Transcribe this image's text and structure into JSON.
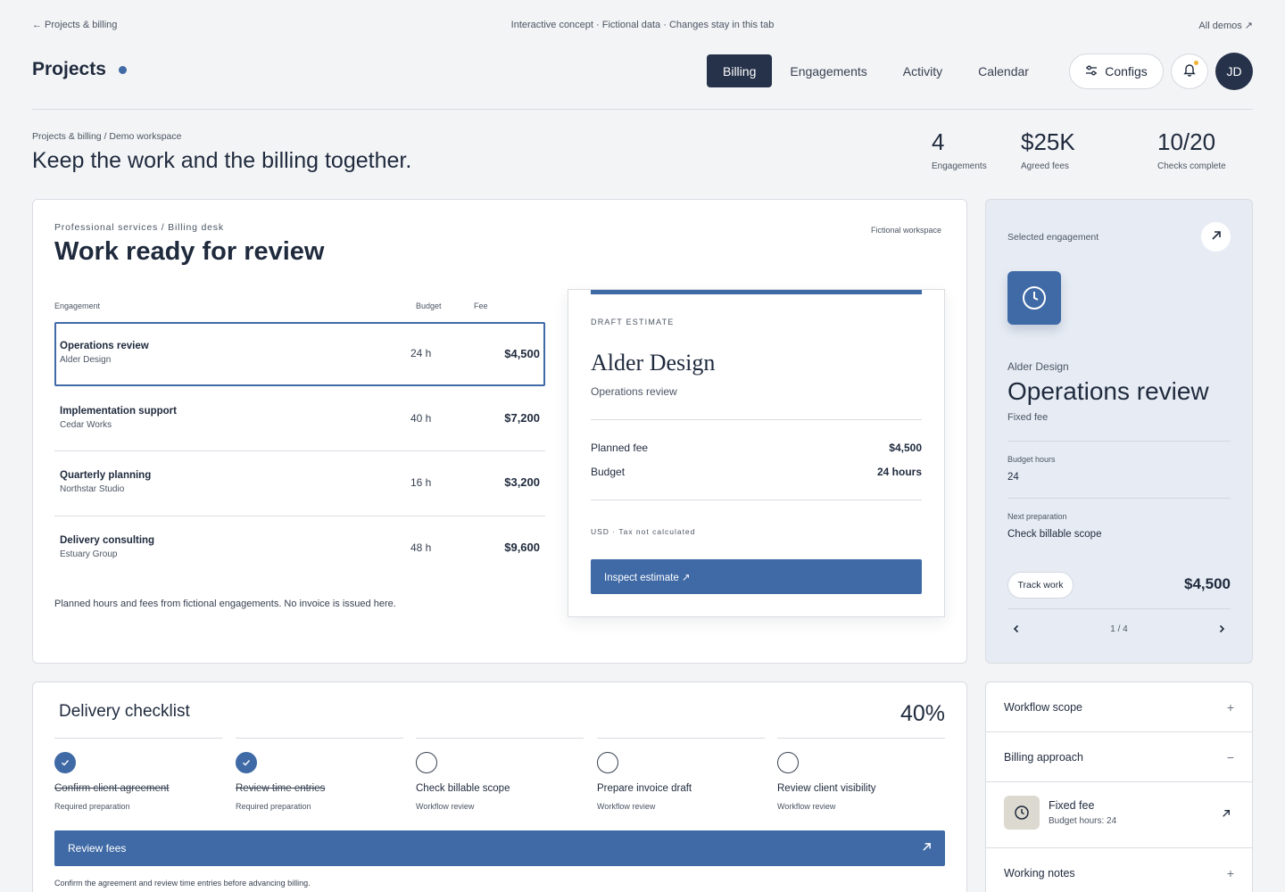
{
  "topbar": {
    "back": "← Projects & billing",
    "notice": "Interactive concept · Fictional data · Changes stay in this tab",
    "demos": "All demos ↗"
  },
  "header": {
    "title": "Projects",
    "tabs": [
      {
        "label": "Billing",
        "active": true
      },
      {
        "label": "Engagements",
        "active": false
      },
      {
        "label": "Activity",
        "active": false
      },
      {
        "label": "Calendar",
        "active": false
      }
    ],
    "configs_label": "Configs",
    "avatar_initials": "JD"
  },
  "intro": {
    "breadcrumb": "Projects & billing / Demo workspace",
    "headline": "Keep the work and the billing together.",
    "stats": [
      {
        "value": "4",
        "label": "Engagements"
      },
      {
        "value": "$25K",
        "label": "Agreed fees"
      },
      {
        "value": "10/20",
        "label": "Checks complete"
      }
    ]
  },
  "review": {
    "eyebrow": "Professional services / Billing desk",
    "title": "Work ready for review",
    "badge": "Fictional workspace",
    "columns": {
      "engagement": "Engagement",
      "budget": "Budget",
      "fee": "Fee"
    },
    "rows": [
      {
        "name": "Operations review",
        "client": "Alder Design",
        "hours": "24 h",
        "fee": "$4,500",
        "selected": true
      },
      {
        "name": "Implementation support",
        "client": "Cedar Works",
        "hours": "40 h",
        "fee": "$7,200",
        "selected": false
      },
      {
        "name": "Quarterly planning",
        "client": "Northstar Studio",
        "hours": "16 h",
        "fee": "$3,200",
        "selected": false
      },
      {
        "name": "Delivery consulting",
        "client": "Estuary Group",
        "hours": "48 h",
        "fee": "$9,600",
        "selected": false
      }
    ],
    "note": "Planned hours and fees from fictional engagements. No invoice is issued here."
  },
  "estimate": {
    "eyebrow": "DRAFT ESTIMATE",
    "client": "Alder Design",
    "engagement": "Operations review",
    "planned_fee_label": "Planned fee",
    "planned_fee_value": "$4,500",
    "budget_label": "Budget",
    "budget_value": "24 hours",
    "note": "USD · Tax not calculated",
    "button": "Inspect estimate ↗"
  },
  "selected": {
    "eyebrow": "Selected engagement",
    "client": "Alder Design",
    "title": "Operations review",
    "type": "Fixed fee",
    "budget_hours_label": "Budget hours",
    "budget_hours_value": "24",
    "next_prep_label": "Next preparation",
    "next_prep_value": "Check billable scope",
    "track_label": "Track work",
    "fee": "$4,500",
    "pager": "1 / 4"
  },
  "checklist": {
    "title": "Delivery checklist",
    "percent": "40%",
    "steps": [
      {
        "label": "Confirm client agreement",
        "sub": "Required preparation",
        "done": true
      },
      {
        "label": "Review time entries",
        "sub": "Required preparation",
        "done": true
      },
      {
        "label": "Check billable scope",
        "sub": "Workflow review",
        "done": false
      },
      {
        "label": "Prepare invoice draft",
        "sub": "Workflow review",
        "done": false
      },
      {
        "label": "Review client visibility",
        "sub": "Workflow review",
        "done": false
      }
    ],
    "button": "Review fees",
    "note": "Confirm the agreement and review time entries before advancing billing."
  },
  "accordion": {
    "items": [
      {
        "label": "Workflow scope",
        "sign": "+"
      },
      {
        "label": "Billing approach",
        "sign": "−"
      },
      {
        "label": "Working notes",
        "sign": "+"
      }
    ],
    "sub_title": "Fixed fee",
    "sub_detail": "Budget hours: 24"
  },
  "colors": {
    "accent": "#3f6aa6",
    "navy": "#26324a",
    "notification": "#f2b134",
    "panel": "#e7ecf4"
  },
  "icons": [
    "sliders-icon",
    "bell-icon",
    "clock-icon",
    "arrow-up-right-icon",
    "chevron-left-icon",
    "chevron-right-icon",
    "check-icon"
  ]
}
